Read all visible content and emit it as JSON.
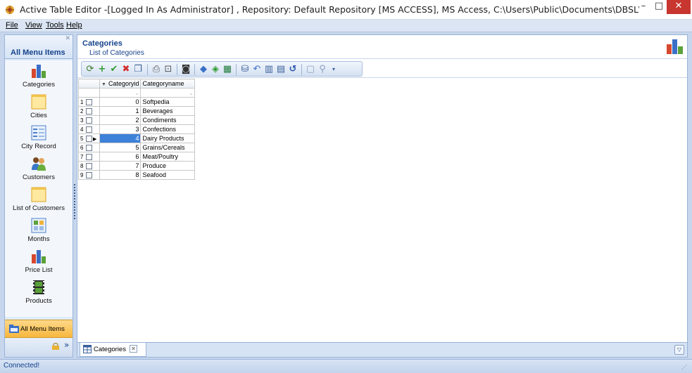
{
  "window": {
    "title": "Active Table Editor -[Logged In As Administrator] , Repository: Default Repository [MS ACCESS], MS Access, C:\\Users\\Public\\Documents\\DBSL\\Active Table Editor\\Rep...",
    "min_glyph": "–",
    "max_glyph": "□",
    "close_glyph": "✕"
  },
  "menu": {
    "file": "File",
    "view": "View",
    "tools": "Tools",
    "help": "Help"
  },
  "nav": {
    "header_title": "All Menu Items",
    "items": [
      {
        "label": "Categories",
        "icon": "bar-chart-icon"
      },
      {
        "label": "Cities",
        "icon": "table-icon"
      },
      {
        "label": "City Record",
        "icon": "form-icon"
      },
      {
        "label": "Customers",
        "icon": "users-icon"
      },
      {
        "label": "List of Customers",
        "icon": "table-icon"
      },
      {
        "label": "Months",
        "icon": "calendar-grid-icon"
      },
      {
        "label": "Price List",
        "icon": "bar-chart-icon"
      },
      {
        "label": "Products",
        "icon": "film-strip-icon"
      }
    ],
    "bottom_button": "All Menu Items"
  },
  "page": {
    "title": "Categories",
    "subtitle": "List of Categories"
  },
  "grid": {
    "columns": [
      "Categoryid",
      "Categoryname"
    ],
    "rows": [
      {
        "num": "1",
        "id": "0",
        "name": "Softpedia"
      },
      {
        "num": "2",
        "id": "1",
        "name": "Beverages"
      },
      {
        "num": "3",
        "id": "2",
        "name": "Condiments"
      },
      {
        "num": "4",
        "id": "3",
        "name": "Confections"
      },
      {
        "num": "5",
        "id": "4",
        "name": "Dairy Products"
      },
      {
        "num": "6",
        "id": "5",
        "name": "Grains/Cereals"
      },
      {
        "num": "7",
        "id": "6",
        "name": "Meat/Poultry"
      },
      {
        "num": "8",
        "id": "7",
        "name": "Produce"
      },
      {
        "num": "9",
        "id": "8",
        "name": "Seafood"
      }
    ],
    "selected_row": 5
  },
  "tabs": {
    "document_tab": "Categories"
  },
  "status": {
    "text": "Connected!"
  },
  "colors": {
    "accent": "#15428b",
    "selection": "#3d81d9",
    "close_button": "#c7362f"
  }
}
